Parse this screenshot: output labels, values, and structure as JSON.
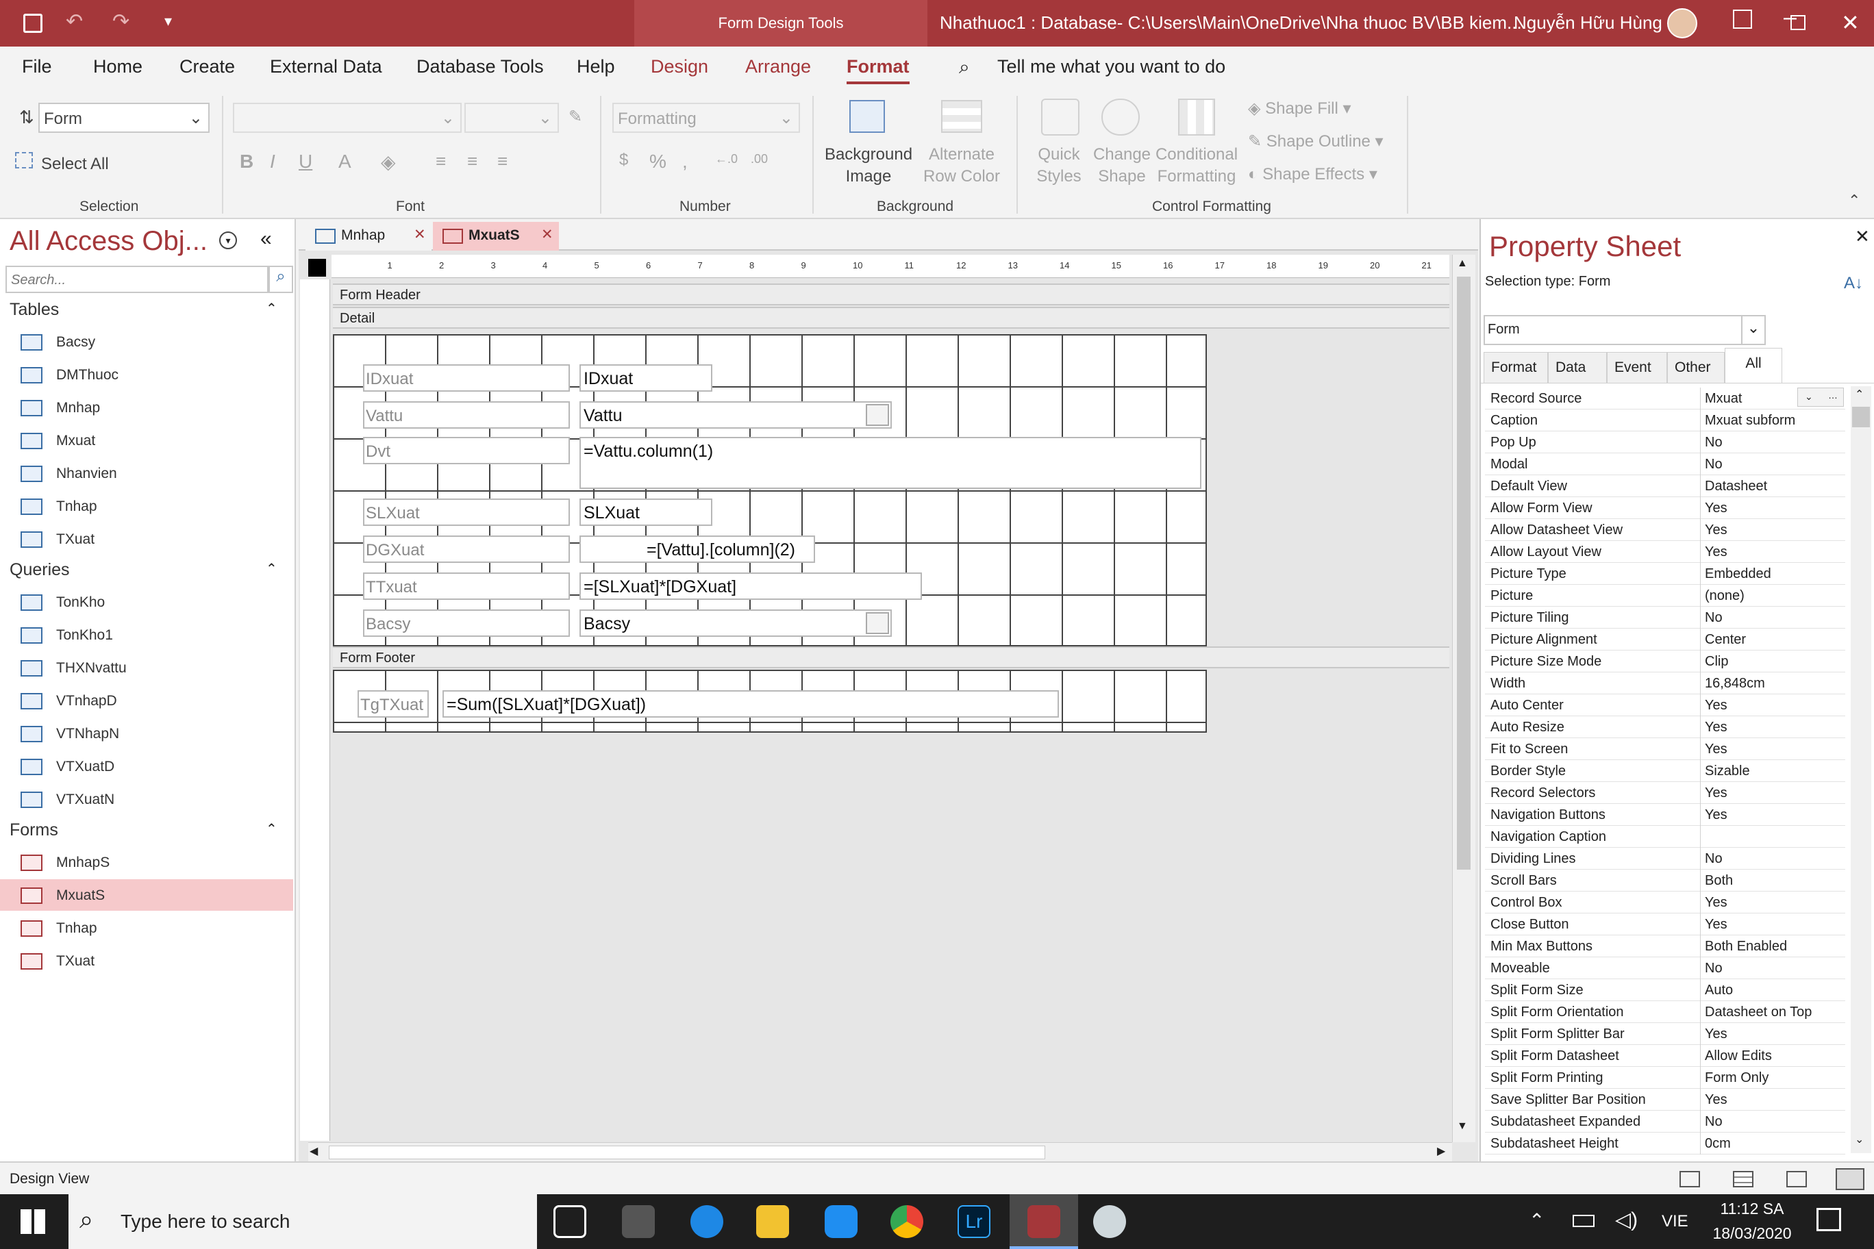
{
  "titlebar": {
    "context_tool": "Form Design Tools",
    "title": "Nhathuoc1 : Database- C:\\Users\\Main\\OneDrive\\Nha thuoc BV\\BB kiem...",
    "user": "Nguyễn Hữu Hùng"
  },
  "ribbon_tabs": [
    "File",
    "Home",
    "Create",
    "External Data",
    "Database Tools",
    "Help",
    "Design",
    "Arrange",
    "Format"
  ],
  "tell_me": "Tell me what you want to do",
  "ribbon": {
    "selection_combo": "Form",
    "select_all": "Select All",
    "number_format": "Formatting",
    "background_image": "Background Image",
    "alternate_row_color": "Alternate Row Color",
    "quick_styles": "Quick Styles",
    "change_shape": "Change Shape",
    "conditional_formatting": "Conditional Formatting",
    "shape_fill": "Shape Fill",
    "shape_outline": "Shape Outline",
    "shape_effects": "Shape Effects",
    "groups": {
      "selection": "Selection",
      "font": "Font",
      "number": "Number",
      "background": "Background",
      "control_formatting": "Control Formatting"
    }
  },
  "nav": {
    "title": "All Access Obj...",
    "search_placeholder": "Search...",
    "sections": [
      {
        "name": "Tables",
        "items": [
          "Bacsy",
          "DMThuoc",
          "Mnhap",
          "Mxuat",
          "Nhanvien",
          "Tnhap",
          "TXuat"
        ]
      },
      {
        "name": "Queries",
        "items": [
          "TonKho",
          "TonKho1",
          "THXNvattu",
          "VTnhapD",
          "VTNhapN",
          "VTXuatD",
          "VTXuatN"
        ]
      },
      {
        "name": "Forms",
        "items": [
          "MnhapS",
          "MxuatS",
          "Tnhap",
          "TXuat"
        ]
      }
    ]
  },
  "doc_tabs": [
    "Mnhap",
    "MxuatS"
  ],
  "ruler_numbers": [
    "1",
    "2",
    "3",
    "4",
    "5",
    "6",
    "7",
    "8",
    "9",
    "10",
    "11",
    "12",
    "13",
    "14",
    "15",
    "16",
    "17",
    "18",
    "19",
    "20",
    "21"
  ],
  "sections": {
    "header": "Form Header",
    "detail": "Detail",
    "footer": "Form Footer"
  },
  "controls": {
    "lbl_idxuat": "IDxuat",
    "txt_idxuat": "IDxuat",
    "lbl_vattu": "Vattu",
    "cbo_vattu": "Vattu",
    "lbl_dvt": "Dvt",
    "txt_dvt": "=Vattu.column(1)",
    "lbl_slxuat": "SLXuat",
    "txt_slxuat": "SLXuat",
    "lbl_dgxuat": "DGXuat",
    "txt_dgxuat": "=[Vattu].[column](2)",
    "lbl_ttxuat": "TTxuat",
    "txt_ttxuat": "=[SLXuat]*[DGXuat]",
    "lbl_bacsy": "Bacsy",
    "cbo_bacsy": "Bacsy",
    "lbl_tgtxuat": "TgTXuat",
    "txt_tgtxuat": "=Sum([SLXuat]*[DGXuat])"
  },
  "property_sheet": {
    "title": "Property Sheet",
    "selection_type": "Selection type:  Form",
    "object": "Form",
    "tabs": [
      "Format",
      "Data",
      "Event",
      "Other",
      "All"
    ],
    "rows": [
      [
        "Record Source",
        "Mxuat"
      ],
      [
        "Caption",
        "Mxuat subform"
      ],
      [
        "Pop Up",
        "No"
      ],
      [
        "Modal",
        "No"
      ],
      [
        "Default View",
        "Datasheet"
      ],
      [
        "Allow Form View",
        "Yes"
      ],
      [
        "Allow Datasheet View",
        "Yes"
      ],
      [
        "Allow Layout View",
        "Yes"
      ],
      [
        "Picture Type",
        "Embedded"
      ],
      [
        "Picture",
        "(none)"
      ],
      [
        "Picture Tiling",
        "No"
      ],
      [
        "Picture Alignment",
        "Center"
      ],
      [
        "Picture Size Mode",
        "Clip"
      ],
      [
        "Width",
        "16,848cm"
      ],
      [
        "Auto Center",
        "Yes"
      ],
      [
        "Auto Resize",
        "Yes"
      ],
      [
        "Fit to Screen",
        "Yes"
      ],
      [
        "Border Style",
        "Sizable"
      ],
      [
        "Record Selectors",
        "Yes"
      ],
      [
        "Navigation Buttons",
        "Yes"
      ],
      [
        "Navigation Caption",
        ""
      ],
      [
        "Dividing Lines",
        "No"
      ],
      [
        "Scroll Bars",
        "Both"
      ],
      [
        "Control Box",
        "Yes"
      ],
      [
        "Close Button",
        "Yes"
      ],
      [
        "Min Max Buttons",
        "Both Enabled"
      ],
      [
        "Moveable",
        "No"
      ],
      [
        "Split Form Size",
        "Auto"
      ],
      [
        "Split Form Orientation",
        "Datasheet on Top"
      ],
      [
        "Split Form Splitter Bar",
        "Yes"
      ],
      [
        "Split Form Datasheet",
        "Allow Edits"
      ],
      [
        "Split Form Printing",
        "Form Only"
      ],
      [
        "Save Splitter Bar Position",
        "Yes"
      ],
      [
        "Subdatasheet Expanded",
        "No"
      ],
      [
        "Subdatasheet Height",
        "0cm"
      ]
    ]
  },
  "status": "Design View",
  "taskbar": {
    "search": "Type here to search",
    "lang": "VIE",
    "time": "11:12 SA",
    "date": "18/03/2020"
  },
  "colors": {
    "accent": "#a4373a",
    "nav_selected": "#f6c9cb"
  }
}
